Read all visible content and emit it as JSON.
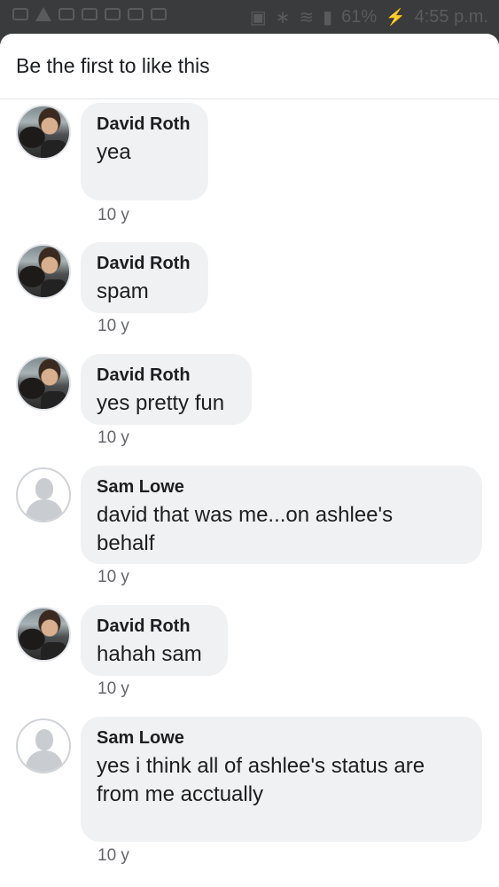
{
  "status_bar": {
    "battery": "61%",
    "time": "4:55 p.m."
  },
  "header": {
    "likes_text": "Be the first to like this"
  },
  "comments": [
    {
      "author": "David Roth",
      "text": "yea",
      "time": "10 y",
      "avatar": "photo"
    },
    {
      "author": "David Roth",
      "text": "spam",
      "time": "10 y",
      "avatar": "photo"
    },
    {
      "author": "David Roth",
      "text": "yes pretty fun",
      "time": "10 y",
      "avatar": "photo"
    },
    {
      "author": "Sam Lowe",
      "text_lines": [
        "david that was me...on ashlee's",
        "behalf"
      ],
      "time": "10 y",
      "avatar": "default"
    },
    {
      "author": "David Roth",
      "text": "hahah sam",
      "time": "10 y",
      "avatar": "photo"
    },
    {
      "author": "Sam Lowe",
      "text_lines": [
        "yes i think all of ashlee's status are",
        "from me acctually"
      ],
      "time": "10 y",
      "avatar": "default"
    }
  ]
}
